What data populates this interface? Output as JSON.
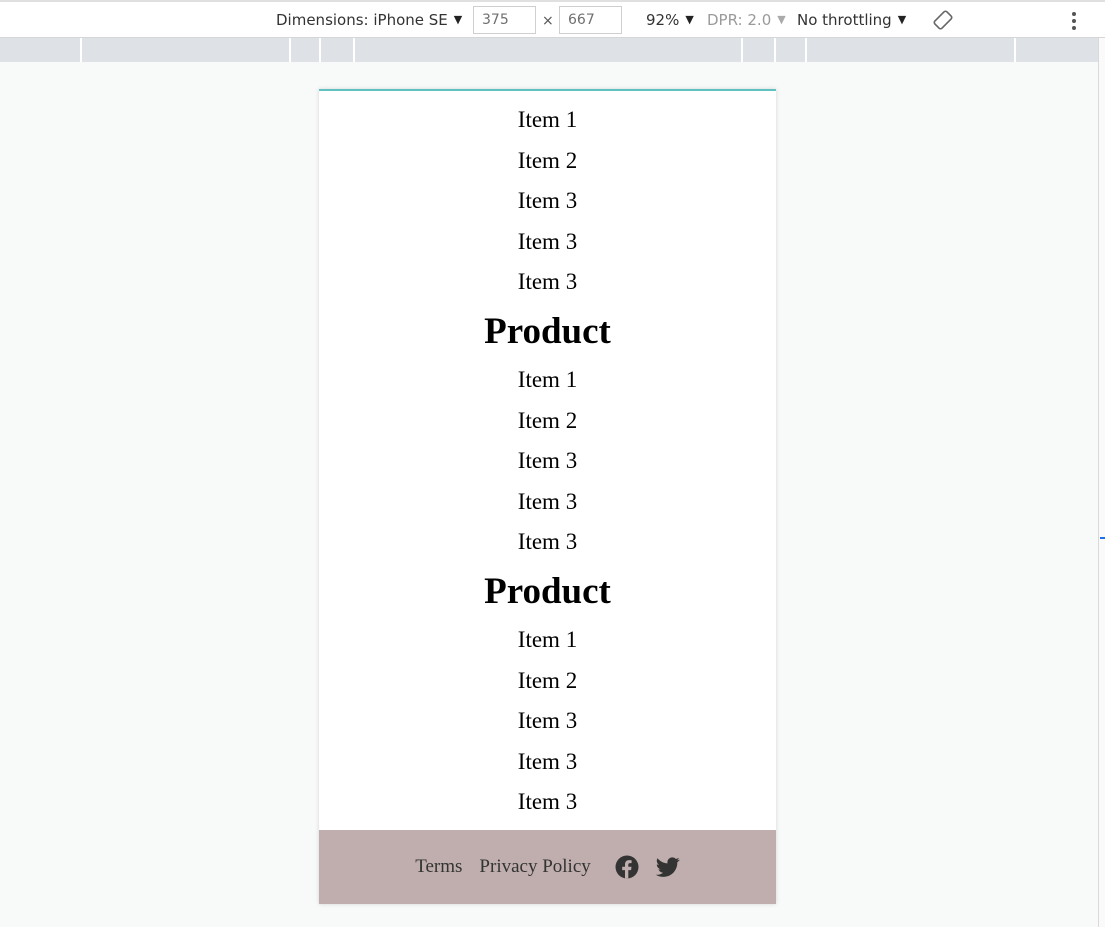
{
  "devtools": {
    "dimensions_label": "Dimensions: iPhone SE",
    "width_value": "375",
    "times_symbol": "×",
    "height_value": "667",
    "zoom": "92%",
    "dpr": "DPR: 2.0",
    "throttling": "No throttling"
  },
  "page": {
    "sections": [
      {
        "title": "",
        "items": [
          "Item 1",
          "Item 2",
          "Item 3",
          "Item 3",
          "Item 3"
        ]
      },
      {
        "title": "Product",
        "items": [
          "Item 1",
          "Item 2",
          "Item 3",
          "Item 3",
          "Item 3"
        ]
      },
      {
        "title": "Product",
        "items": [
          "Item 1",
          "Item 2",
          "Item 3",
          "Item 3",
          "Item 3"
        ]
      }
    ],
    "footer": {
      "terms": "Terms",
      "privacy": "Privacy Policy",
      "icons": [
        "facebook-icon",
        "twitter-icon"
      ],
      "background": "#bfaead"
    }
  },
  "colors": {
    "viewport_top_border": "#5fc1c0",
    "ruler": "#dee1e6"
  }
}
